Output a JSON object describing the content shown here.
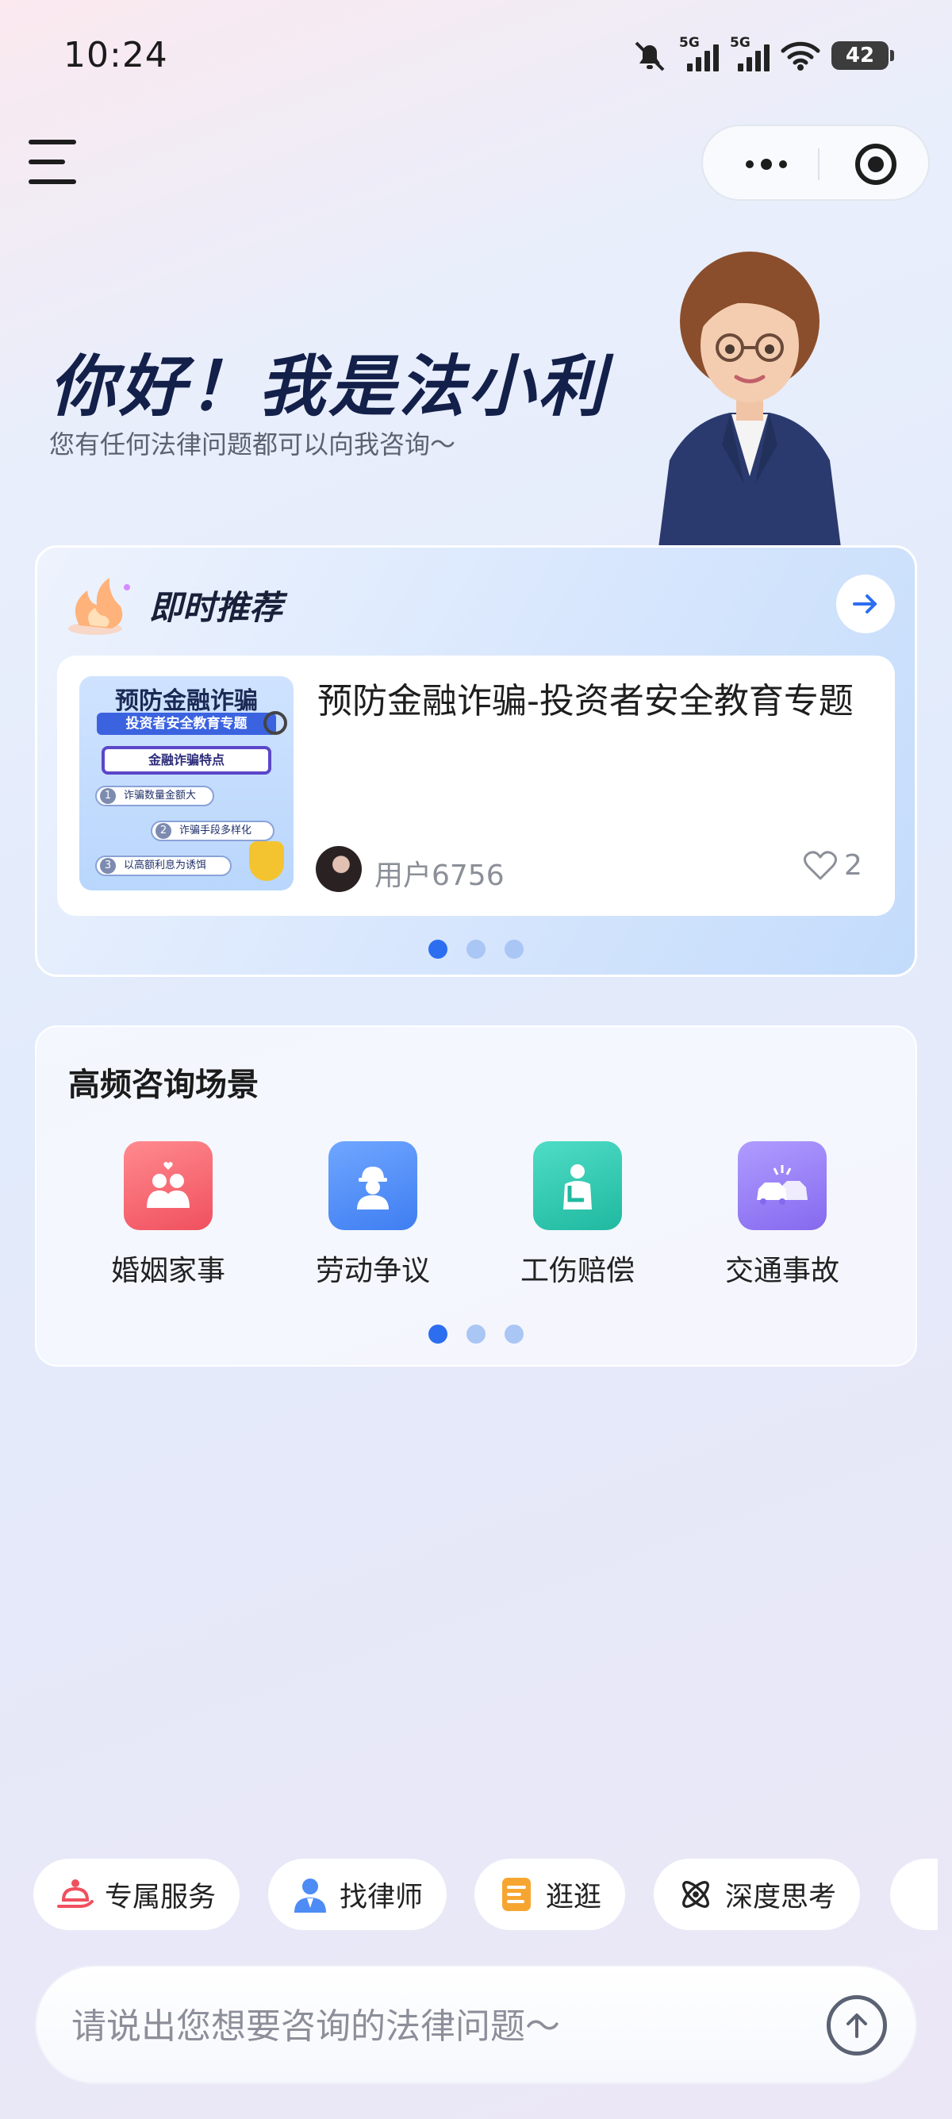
{
  "status_bar": {
    "time": "10:24",
    "battery": "42",
    "network1": "5G",
    "network2": "5G"
  },
  "hero": {
    "title": "你好！我是法小利",
    "subtitle": "您有任何法律问题都可以向我咨询～"
  },
  "recommend": {
    "title": "即时推荐",
    "item": {
      "headline": "预防金融诈骗-投资者安全教育专题",
      "thumbnail": {
        "title": "预防金融诈骗",
        "banner": "投资者安全教育专题",
        "box": "金融诈骗特点",
        "points": [
          "诈骗数量金额大",
          "诈骗手段多样化",
          "以高额利息为诱饵"
        ]
      },
      "user": "用户6756",
      "likes": "2"
    },
    "pagination": {
      "total": 3,
      "active": 0
    }
  },
  "scenes": {
    "title": "高频咨询场景",
    "items": [
      {
        "label": "婚姻家事",
        "icon": "couple-icon",
        "color": "#f2606c"
      },
      {
        "label": "劳动争议",
        "icon": "worker-icon",
        "color": "#4d8bf5"
      },
      {
        "label": "工伤赔偿",
        "icon": "injury-icon",
        "color": "#2fc7b0"
      },
      {
        "label": "交通事故",
        "icon": "car-accident-icon",
        "color": "#8f7bf0"
      }
    ],
    "pagination": {
      "total": 3,
      "active": 0
    }
  },
  "chips": [
    {
      "label": "专属服务",
      "icon": "service-bell-icon"
    },
    {
      "label": "找律师",
      "icon": "lawyer-icon"
    },
    {
      "label": "逛逛",
      "icon": "browse-icon"
    },
    {
      "label": "深度思考",
      "icon": "atom-icon"
    }
  ],
  "input": {
    "placeholder": "请说出您想要咨询的法律问题～"
  }
}
